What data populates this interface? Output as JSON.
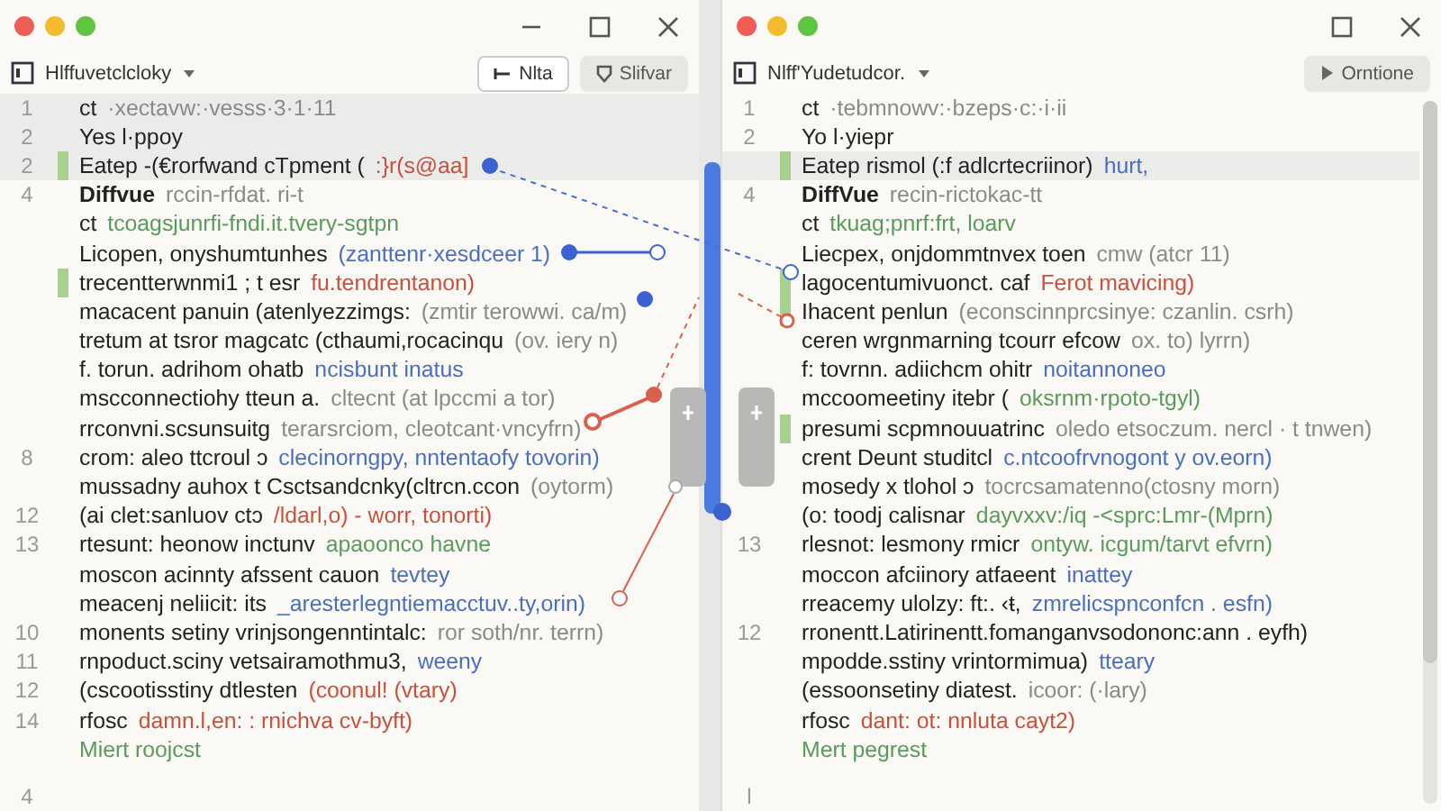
{
  "panes": [
    {
      "title": "Hlffuvetclcloky",
      "window_controls": [
        {
          "kind": "minimize"
        },
        {
          "kind": "maximize"
        },
        {
          "kind": "close"
        }
      ],
      "buttons": [
        {
          "label": "Nlta",
          "kind": "add"
        },
        {
          "label": "Slifvar",
          "kind": "filter"
        }
      ],
      "lines": [
        {
          "num": "1",
          "code": "ct",
          "tail": "·xectavw:·vesss·3·1·11",
          "color": "#8a8a8a",
          "changed": false,
          "highlighted": true
        },
        {
          "num": "2",
          "code": "Yes l·ppoy",
          "changed": false,
          "highlighted": true
        },
        {
          "num": "2",
          "code": "Eatep -(€rorfwand cTpment (",
          "tail": ":}r(s@aa]",
          "color": "#c8503c",
          "changed": true,
          "highlighted": true
        },
        {
          "num": "4",
          "code": "Diffvue",
          "bold": true,
          "tail": "rccin-rfdat. ri-t",
          "color": "#8a8a8a",
          "changed": false,
          "highlighted": false
        },
        {
          "code": "ct",
          "tail": "tcoagsjunrfi-fndi.it.tvery-sgtpn",
          "color": "#5a9a5a",
          "changed": false,
          "highlighted": false
        },
        {
          "code": "Licopen, onyshumtunhes",
          "tail": "(zanttenr·xesdceer 1)",
          "color": "#4a6fc0",
          "changed": false,
          "highlighted": false
        },
        {
          "code": "trecentterwnmi1 ; t esr",
          "tail": "fu.tendrentanon)",
          "color": "#c8503c",
          "changed": true,
          "highlighted": false
        },
        {
          "code": "macacent panuin (atenlyezzimgs:",
          "tail": "(zmtir terowwi. ca/m)",
          "color": "#8a8a8a",
          "changed": false,
          "highlighted": false
        },
        {
          "code": "tretum at tsror magcatc (cthaumi,rocacinqu",
          "tail": "(ov. iery n)",
          "color": "#8a8a8a",
          "changed": false,
          "highlighted": false
        },
        {
          "code": "f. torun. adrihom ohatb",
          "tail": "ncisbunt inatus",
          "color": "#4a6fc0",
          "changed": false,
          "highlighted": false
        },
        {
          "code": "mscconnectiohy tteun a.",
          "tail": "cltecnt (at lpccmi a tor)",
          "color": "#8a8a8a",
          "changed": false,
          "highlighted": false
        },
        {
          "code": "rrconvni.scsunsuitg",
          "tail": "terarsrciom, cleotcant·vncyfrn)",
          "color": "#8a8a8a",
          "changed": false,
          "highlighted": false
        },
        {
          "num": "8",
          "code": "crom: aleo ttcroul ɔ",
          "tail": "clecinorngpy, nntentaofy tovorin)",
          "color": "#4a6fc0",
          "changed": false,
          "highlighted": false
        },
        {
          "code": "mussadny auhox t Csctsandcnky(cltrcn.ccon",
          "tail": "(oytorm)",
          "color": "#8a8a8a",
          "changed": false,
          "highlighted": false
        },
        {
          "num": "12",
          "code": "(ai clet:sanluov ctɔ",
          "tail": "/ldarl,o) - worr, tonorti)",
          "color": "#c8503c",
          "changed": false,
          "highlighted": false
        },
        {
          "num": "13",
          "code": "rtesunt: heonow inctunv",
          "tail": "apaoonco  havne",
          "color": "#5a9a5a",
          "changed": false,
          "highlighted": false
        },
        {
          "code": "moscon  acinnty afssent cauon",
          "tail": "tevtey",
          "color": "#4a6fc0",
          "changed": false,
          "highlighted": false
        },
        {
          "code": "meacenj neliicit: its",
          "tail": "_aresterlegntiemacctuv..ty,orin)",
          "color": "#4a6fc0",
          "changed": false,
          "highlighted": false
        },
        {
          "num": "10",
          "code": "monents setiny vrinjsongenntintalc:",
          "tail": "ror soth/nr. terrn)",
          "color": "#8a8a8a",
          "changed": false,
          "highlighted": false
        },
        {
          "num": "11",
          "code": "rnpoduct.sciny vetsairamothmu3,",
          "tail": "weeny",
          "color": "#4a6fc0",
          "changed": false,
          "highlighted": false
        },
        {
          "num": "12",
          "code": "(cscootisstiny dtlesten",
          "tail": "(coonul! (vtary)",
          "color": "#c8503c",
          "changed": false,
          "highlighted": false
        },
        {
          "num": "14",
          "code": "rfosc",
          "tail": "damn.l,en: : rnichva cv-byft)",
          "color": "#c8503c",
          "changed": false,
          "highlighted": false
        },
        {
          "tail": "Miert roojcst",
          "color": "#5a9a5a",
          "changed": false,
          "highlighted": false
        },
        {
          "num": "4",
          "changed": false,
          "highlighted": false
        }
      ]
    },
    {
      "title": "Nlff'Yudetudcor.",
      "window_controls": [
        {
          "kind": "maximize"
        },
        {
          "kind": "close"
        }
      ],
      "buttons": [
        {
          "label": "Orntione",
          "kind": "run"
        }
      ],
      "lines": [
        {
          "num": "1",
          "code": "ct",
          "tail": "·tebmnowv:·bzeps·c:·i·ii",
          "color": "#8a8a8a",
          "changed": false,
          "highlighted": false
        },
        {
          "num": "2",
          "code": "Yo l·yiepr",
          "changed": false,
          "highlighted": false
        },
        {
          "code": "Eatep rismol (:f adlcrtecriinor)",
          "tail": "hurt,",
          "color": "#4a6fc0",
          "changed": true,
          "highlighted": true
        },
        {
          "num": "4",
          "code": "DiffVue",
          "bold": true,
          "tail": "recin-rictokac-tt",
          "color": "#8a8a8a",
          "changed": false,
          "highlighted": false
        },
        {
          "code": "ct",
          "tail": "tkuag;pnrf:frt, loarv",
          "color": "#5a9a5a",
          "changed": false,
          "highlighted": false
        },
        {
          "code": "Liecpex, onjdommtnvex toen",
          "tail": "cmw (atcr 11)",
          "color": "#8a8a8a",
          "changed": false,
          "highlighted": false
        },
        {
          "code": "lagocentumivuonct. caf",
          "tail": "Ferot mavicing)",
          "color": "#c8503c",
          "changed": true,
          "highlighted": false
        },
        {
          "code": "Ihacent penlun",
          "tail": "(econscinnprcsinye: czanlin. csrh)",
          "color": "#8a8a8a",
          "changed": true,
          "highlighted": false
        },
        {
          "code": "ceren  wrgnmarning tcourr efcow",
          "tail": "ox. to) lyrrn)",
          "color": "#8a8a8a",
          "changed": false,
          "highlighted": false
        },
        {
          "code": "f: tovrnn. adiichcm ohitr",
          "tail": "noitannoneo",
          "color": "#4a6fc0",
          "changed": false,
          "highlighted": false
        },
        {
          "code": "mccoomeetiny itebr (",
          "tail": "oksrnm·rpoto-tgyl)",
          "color": "#5a9a5a",
          "changed": false,
          "highlighted": false
        },
        {
          "code": "presumi scpmnouuatrinc",
          "tail": "oledo etsoczum. nercl · t tnwen)",
          "color": "#8a8a8a",
          "changed": true,
          "highlighted": false
        },
        {
          "code": "crent  Deunt  studitcl",
          "tail": "c.ntcoofrvnogont y ov.eorn)",
          "color": "#4a6fc0",
          "changed": false,
          "highlighted": false
        },
        {
          "code": "mosedy x tlohol ɔ",
          "tail": "tocrcsamatenno(ctosny morn)",
          "color": "#8a8a8a",
          "changed": false,
          "highlighted": false
        },
        {
          "code": "(o: toodj calisnar",
          "tail": "dayvxxv:/iq  -<sprc:Lmr-(Mprn)",
          "color": "#5a9a5a",
          "changed": false,
          "highlighted": false
        },
        {
          "num": "13",
          "code": "rlesnot: lesmony rmicr",
          "tail": "ontyw. icgum/tarvt efvrn)",
          "color": "#5a9a5a",
          "changed": false,
          "highlighted": false
        },
        {
          "code": "moccon  afciinory atfaeent",
          "tail": "inattey",
          "color": "#4a6fc0",
          "changed": false,
          "highlighted": false
        },
        {
          "code": "rreacemy ulolzy: ft:. ‹ŧ,",
          "tail": "zmrelicspnconfcn . esfn)",
          "color": "#4a6fc0",
          "changed": false,
          "highlighted": false
        },
        {
          "num": "12",
          "code": "rronentt.Latirinentt.fomanganvsodononc:ann . eyfh)",
          "changed": false,
          "highlighted": false
        },
        {
          "code": "mpodde.sstiny vrintormimua)",
          "tail": "tteary",
          "color": "#4a6fc0",
          "changed": false,
          "highlighted": false
        },
        {
          "code": "(essoonsetiny diatest.",
          "tail": "icoor: (·lary)",
          "color": "#8a8a8a",
          "changed": false,
          "highlighted": false
        },
        {
          "code": "rfosc",
          "tail": "dant: ot: nnluta cayt2)",
          "color": "#c8503c",
          "changed": false,
          "highlighted": false
        },
        {
          "tail": "Mert pegrest",
          "color": "#5a9a5a",
          "changed": false,
          "highlighted": false
        },
        {
          "num": "l",
          "changed": false,
          "highlighted": false
        }
      ]
    }
  ]
}
